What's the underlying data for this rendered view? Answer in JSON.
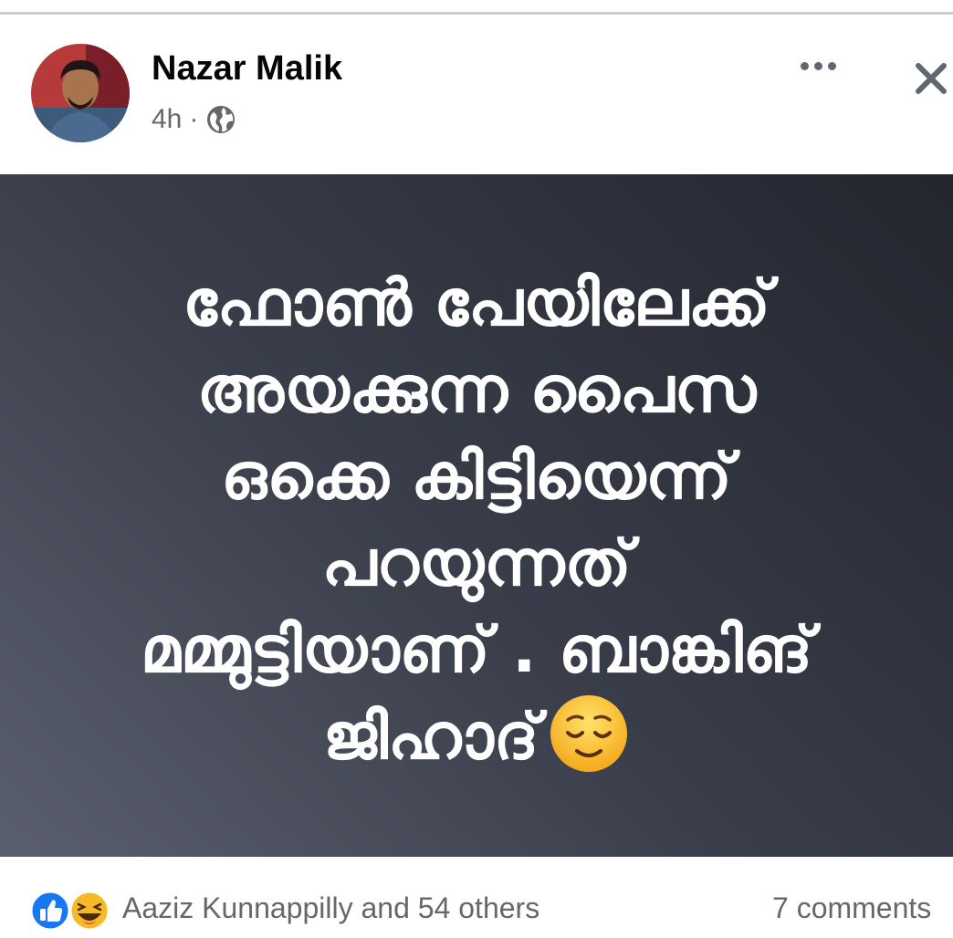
{
  "post": {
    "author": "Nazar Malik",
    "time": "4h",
    "separator": "·",
    "privacy_icon": "globe-icon",
    "text_lines": [
      "ഫോൺ പേയിലേക്ക്",
      "അയക്കുന്ന പൈസ",
      "ഒക്കെ കിട്ടിയെന്ന്",
      "പറയുന്നത്",
      "മമ്മുട്ടിയാണ് . ബാങ്കിങ്",
      "ജിഹാദ്"
    ],
    "emoji": "relieved-face-emoji",
    "background_colors": [
      "#5a5f6e",
      "#23262f"
    ]
  },
  "footer": {
    "reaction_icons": [
      "like-icon",
      "haha-icon"
    ],
    "reactors": "Aaziz Kunnappilly and 54 others",
    "comments": "7 comments"
  },
  "colors": {
    "like_blue": "#1877f2",
    "haha_yellow": "#f7b928",
    "muted_text": "#65676b"
  }
}
